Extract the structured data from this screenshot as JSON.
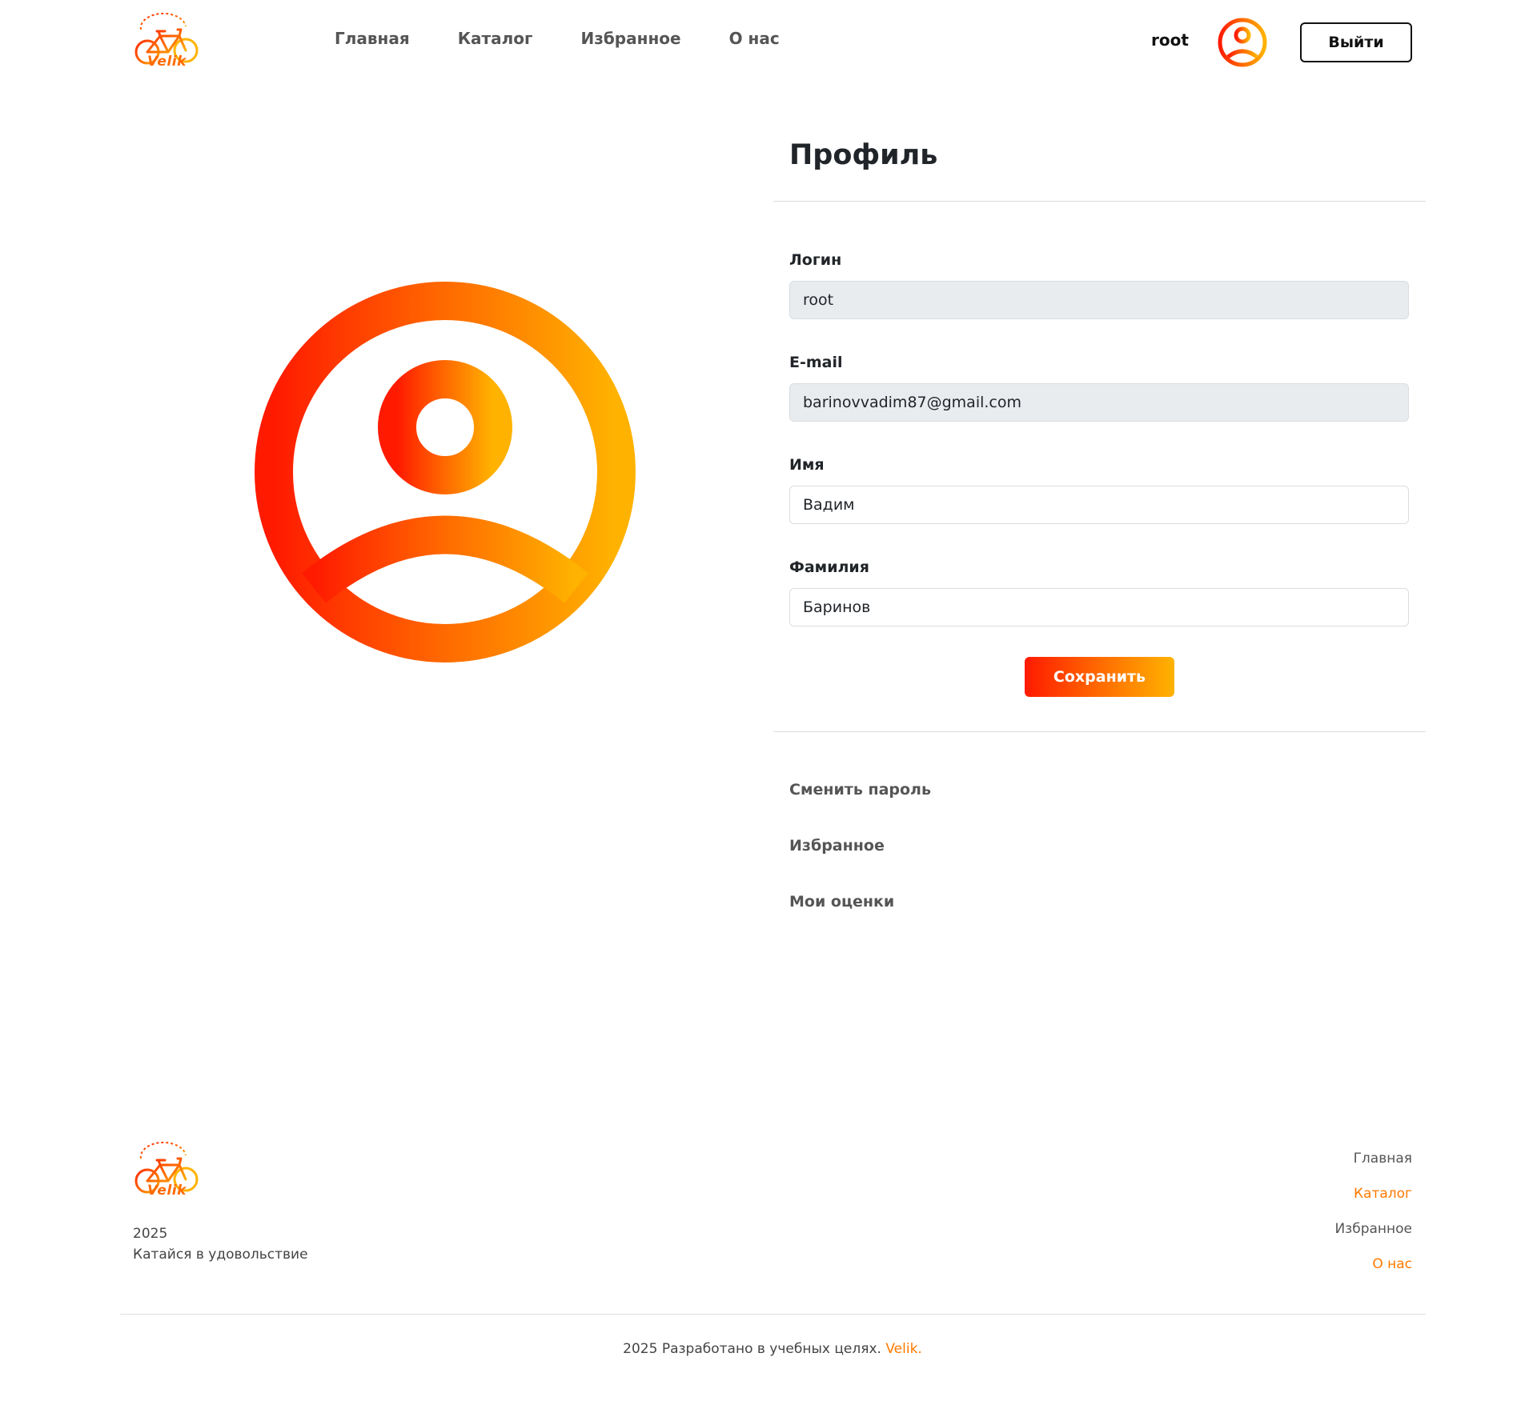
{
  "header": {
    "logo_text": "Velik",
    "nav": [
      {
        "label": "Главная"
      },
      {
        "label": "Каталог"
      },
      {
        "label": "Избранное"
      },
      {
        "label": "О нас"
      }
    ],
    "username": "root",
    "avatar_icon": "user-circle-icon",
    "logout_label": "Выйти"
  },
  "profile": {
    "title": "Профиль",
    "fields": {
      "login": {
        "label": "Логин",
        "value": "root"
      },
      "email": {
        "label": "E-mail",
        "value": "barinovvadim87@gmail.com"
      },
      "first_name": {
        "label": "Имя",
        "value": "Вадим"
      },
      "last_name": {
        "label": "Фамилия",
        "value": "Баринов"
      }
    },
    "save_label": "Сохранить",
    "links": [
      {
        "label": "Сменить пароль"
      },
      {
        "label": "Избранное"
      },
      {
        "label": "Мои оценки"
      }
    ]
  },
  "footer": {
    "logo_text": "Velik",
    "year": "2025",
    "tagline": "Катайся в удовольствие",
    "nav": [
      {
        "label": "Главная"
      },
      {
        "label": "Каталог"
      },
      {
        "label": "Избранное"
      },
      {
        "label": "О нас"
      }
    ],
    "copyright_text": "2025 Разработано в учебных целях.",
    "copyright_brand": "Velik."
  },
  "colors": {
    "gradient_start": "#ff1a00",
    "gradient_mid": "#ff6a00",
    "gradient_end": "#ffb300",
    "accent_text": "#ff7a00",
    "readonly_bg": "#e9ecef"
  }
}
